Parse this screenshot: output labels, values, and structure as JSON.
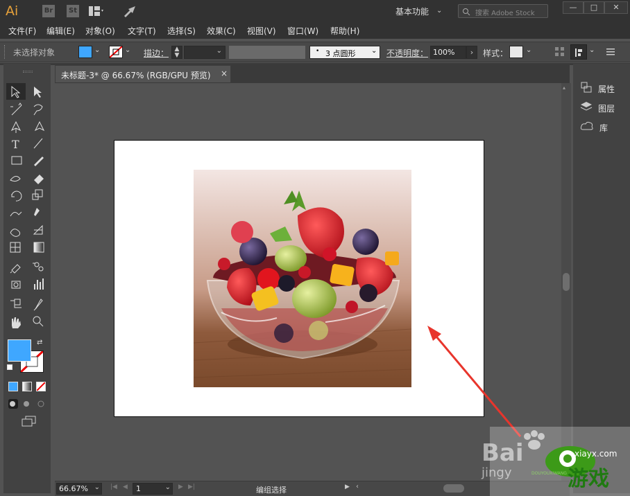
{
  "app": {
    "logo": "Ai",
    "bridge": "Br",
    "stock": "St",
    "workspace": "基本功能",
    "search_placeholder": "搜索 Adobe Stock"
  },
  "menu": [
    "文件(F)",
    "编辑(E)",
    "对象(O)",
    "文字(T)",
    "选择(S)",
    "效果(C)",
    "视图(V)",
    "窗口(W)",
    "帮助(H)"
  ],
  "control": {
    "selection": "未选择对象",
    "stroke_label": "描边：",
    "brush": "3 点圆形",
    "opacity_label": "不透明度：",
    "opacity": "100%",
    "style_label": "样式："
  },
  "document": {
    "tab_title": "未标题-3* @ 66.67% (RGB/GPU 预览)",
    "close": "×"
  },
  "panels": [
    "属性",
    "图层",
    "库"
  ],
  "status": {
    "zoom": "66.67%",
    "artboard": "1",
    "mode": "编组选择"
  },
  "watermark": {
    "baidu": "Bai",
    "jingyan": "jingy",
    "site": "xiayx.com",
    "game": "游戏",
    "sub": "DOUYOUXIWANG"
  },
  "colors": {
    "fill": "#3fa7ff",
    "titlebar": "#323232",
    "canvas": "#535353",
    "arrow": "#e8352c"
  }
}
